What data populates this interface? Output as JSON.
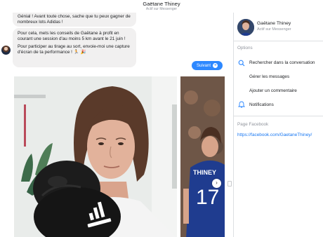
{
  "header": {
    "name": "Gaëtane Thiney",
    "status": "Actif sur Messenger"
  },
  "chat": {
    "messages": [
      "Génial ! Avant toute chose, sache que tu peux gagner de nombreux lots Adidas !",
      "Pour cela, mets les conseils de Gaëtane à profit en courant une session d'au moins 5 km avant le 21 juin !",
      "Pour participer au tirage au sort, envoie-moi une capture d'écran de ta performance ! 🏃 🎉"
    ],
    "follow_button": "Suivant"
  },
  "photos": {
    "jersey_name": "THINEY",
    "jersey_number": "17"
  },
  "info_panel": {
    "name": "Gaëtane Thiney",
    "status": "Actif sur Messenger",
    "options_title": "Options",
    "options": [
      {
        "label": "Rechercher dans la conversation",
        "icon": "search-icon"
      },
      {
        "label": "Gérer les messages",
        "icon": ""
      },
      {
        "label": "Ajouter un commentaire",
        "icon": ""
      },
      {
        "label": "Notifications",
        "icon": "bell-icon"
      }
    ],
    "facebook_title": "Page Facebook",
    "facebook_link": "https://facebook.com/GaetaneThiney/"
  },
  "colors": {
    "accent": "#2d88ff",
    "link": "#1877f2",
    "bubble": "#f1f0f0",
    "muted_text": "#90949c"
  }
}
